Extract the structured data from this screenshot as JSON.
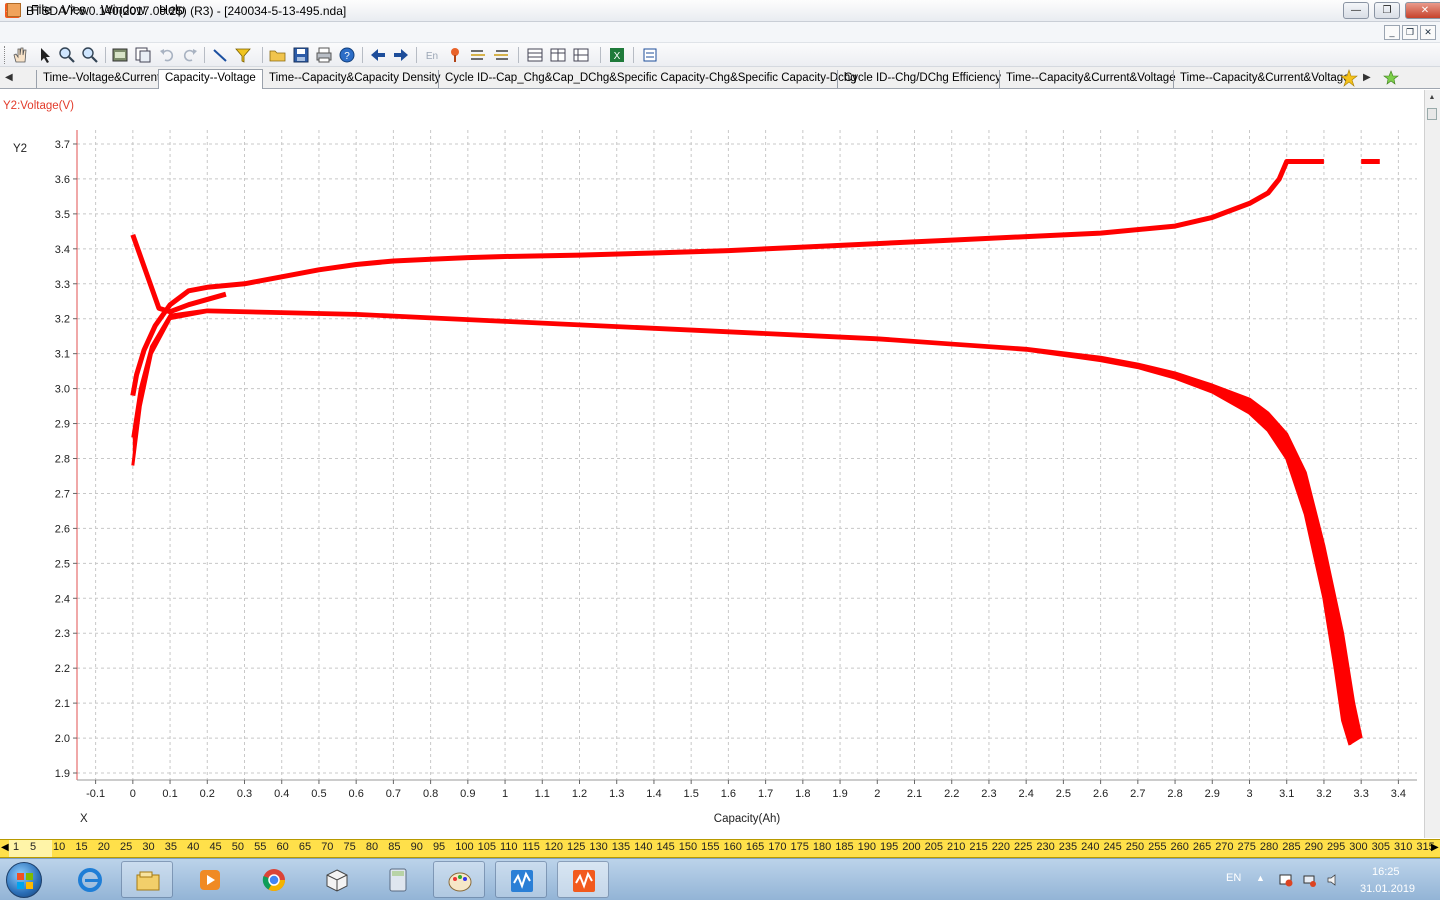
{
  "window": {
    "title": "BTSDA 7.6.0.140(2017.09.25) (R3) - [240034-5-13-495.nda]",
    "minimize": "—",
    "restore": "❐",
    "close": "✕"
  },
  "menu": {
    "items": [
      "File",
      "View",
      "Window",
      "Help"
    ]
  },
  "toolbar": {
    "icons": [
      "hand-icon",
      "pointer-icon",
      "zoom-in-icon",
      "zoom-out-icon",
      "report-icon",
      "export-icon",
      "undo-icon",
      "redo-icon",
      "line-tool-icon",
      "filter-icon",
      "open-icon",
      "save-icon",
      "print-icon",
      "help-icon",
      "back-icon",
      "forward-icon",
      "en-icon",
      "marker-icon",
      "list-icon",
      "list2-icon",
      "grid-icon",
      "grid2-icon",
      "grid3-icon",
      "excel-icon",
      "settings-icon"
    ]
  },
  "tabs": {
    "items": [
      "Time--Voltage&Current",
      "Capacity--Voltage",
      "Time--Capacity&Capacity Density",
      "Cycle ID--Cap_Chg&Cap_DChg&Specific Capacity-Chg&Specific Capacity-Dchg",
      "Cycle ID--Chg/DChg Efficiency",
      "Time--Capacity&Current&Voltage",
      "Time--Capacity&Current&Voltage"
    ],
    "active_index": 1
  },
  "chart_caption": "Y2:Voltage(V)",
  "chart_data": {
    "type": "line",
    "y_label": "Y2",
    "x_axis_label": "X",
    "xlabel": "Capacity(Ah)",
    "xlim": [
      -0.15,
      3.45
    ],
    "ylim": [
      1.88,
      3.74
    ],
    "x_ticks": [
      -0.1,
      0,
      0.1,
      0.2,
      0.3,
      0.4,
      0.5,
      0.6,
      0.7,
      0.8,
      0.9,
      1.0,
      1.1,
      1.2,
      1.3,
      1.4,
      1.5,
      1.6,
      1.7,
      1.8,
      1.9,
      2.0,
      2.1,
      2.2,
      2.3,
      2.4,
      2.5,
      2.6,
      2.7,
      2.8,
      2.9,
      3.0,
      3.1,
      3.2,
      3.3,
      3.4
    ],
    "y_ticks": [
      1.9,
      2.0,
      2.1,
      2.2,
      2.3,
      2.4,
      2.5,
      2.6,
      2.7,
      2.8,
      2.9,
      3.0,
      3.1,
      3.2,
      3.3,
      3.4,
      3.5,
      3.6,
      3.7
    ],
    "grid": true,
    "line_color": "#ff0000",
    "series": [
      {
        "name": "",
        "x": [
          0.0,
          0.01,
          0.03,
          0.06,
          0.1,
          0.15,
          0.2,
          0.3,
          0.4,
          0.5,
          0.6,
          0.7,
          0.8,
          0.9,
          1.0,
          1.2,
          1.4,
          1.6,
          1.8,
          2.0,
          2.2,
          2.4,
          2.6,
          2.8,
          2.9,
          3.0,
          3.05,
          3.08,
          3.1,
          3.15,
          3.2
        ],
        "y": [
          2.98,
          3.04,
          3.11,
          3.18,
          3.24,
          3.28,
          3.29,
          3.3,
          3.32,
          3.34,
          3.355,
          3.365,
          3.37,
          3.375,
          3.378,
          3.382,
          3.388,
          3.395,
          3.405,
          3.415,
          3.425,
          3.435,
          3.445,
          3.465,
          3.49,
          3.53,
          3.56,
          3.6,
          3.65,
          3.65,
          3.65
        ]
      },
      {
        "name": "",
        "x": [
          0.0,
          0.02,
          0.05,
          0.1,
          0.2,
          0.4,
          0.6,
          0.8,
          1.0,
          1.2,
          1.4,
          1.6,
          1.8,
          2.0,
          2.2,
          2.4,
          2.6,
          2.7,
          2.8,
          2.9,
          3.0,
          3.05,
          3.1,
          3.15,
          3.2,
          3.23,
          3.25,
          3.27
        ],
        "y": [
          2.78,
          2.95,
          3.1,
          3.2,
          3.22,
          3.215,
          3.21,
          3.2,
          3.19,
          3.18,
          3.17,
          3.16,
          3.15,
          3.14,
          3.125,
          3.11,
          3.08,
          3.06,
          3.03,
          2.99,
          2.93,
          2.88,
          2.8,
          2.64,
          2.4,
          2.2,
          2.05,
          1.98
        ]
      },
      {
        "name": "",
        "x": [
          0.0,
          0.02,
          0.05,
          0.1,
          0.2,
          0.4,
          0.6,
          0.8,
          1.0,
          1.2,
          1.4,
          1.6,
          1.8,
          2.0,
          2.2,
          2.4,
          2.6,
          2.7,
          2.8,
          2.9,
          3.0,
          3.05,
          3.1,
          3.15,
          3.2,
          3.25,
          3.28,
          3.3
        ],
        "y": [
          2.86,
          3.0,
          3.12,
          3.21,
          3.225,
          3.22,
          3.215,
          3.205,
          3.195,
          3.185,
          3.175,
          3.165,
          3.155,
          3.145,
          3.13,
          3.115,
          3.09,
          3.07,
          3.045,
          3.01,
          2.97,
          2.93,
          2.87,
          2.76,
          2.55,
          2.3,
          2.1,
          2.0
        ]
      },
      {
        "name": "",
        "x": [
          0.0,
          0.03,
          0.07,
          0.1,
          0.15,
          0.25
        ],
        "y": [
          3.44,
          3.35,
          3.23,
          3.22,
          3.24,
          3.27
        ]
      },
      {
        "name": "",
        "x": [
          3.3,
          3.35
        ],
        "y": [
          3.65,
          3.65
        ]
      }
    ]
  },
  "ruler": {
    "labels": [
      "1",
      "5",
      "10",
      "15",
      "20",
      "25",
      "30",
      "35",
      "40",
      "45",
      "50",
      "55",
      "60",
      "65",
      "70",
      "75",
      "80",
      "85",
      "90",
      "95",
      "100",
      "105",
      "110",
      "115",
      "120",
      "125",
      "130",
      "135",
      "140",
      "145",
      "150",
      "155",
      "160",
      "165",
      "170",
      "175",
      "180",
      "185",
      "190",
      "195",
      "200",
      "205",
      "210",
      "215",
      "220",
      "225",
      "230",
      "235",
      "240",
      "245",
      "250",
      "255",
      "260",
      "265",
      "270",
      "275",
      "280",
      "285",
      "290",
      "295",
      "300",
      "305",
      "310",
      "315"
    ]
  },
  "taskbar": {
    "apps": [
      "ie-icon",
      "explorer-icon",
      "media-player-icon",
      "chrome-icon",
      "box-icon",
      "calculator-icon",
      "paint-icon",
      "btsda-icon",
      "btsda-active-icon"
    ],
    "lang": "EN",
    "time": "16:25",
    "date": "31.01.2019"
  }
}
